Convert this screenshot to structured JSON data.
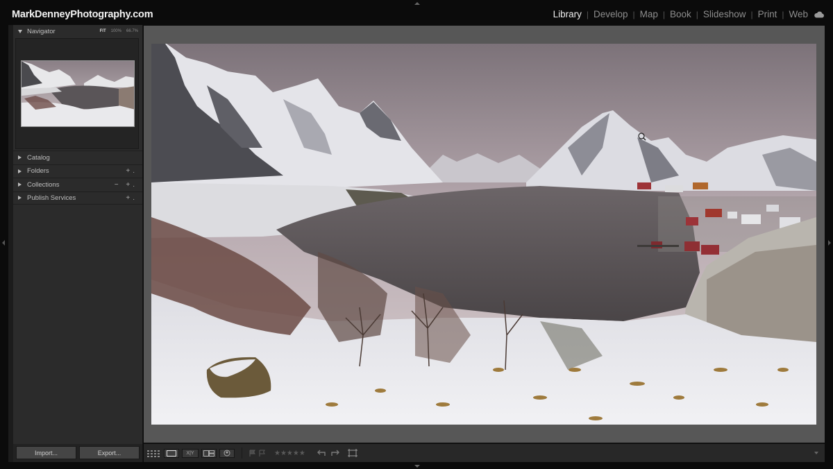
{
  "identity_plate": "MarkDenneyPhotography.com",
  "modules": [
    {
      "label": "Library",
      "active": true
    },
    {
      "label": "Develop",
      "active": false
    },
    {
      "label": "Map",
      "active": false
    },
    {
      "label": "Book",
      "active": false
    },
    {
      "label": "Slideshow",
      "active": false
    },
    {
      "label": "Print",
      "active": false
    },
    {
      "label": "Web",
      "active": false
    }
  ],
  "navigator": {
    "title": "Navigator",
    "zoom_options": [
      "FIT",
      "100%",
      "66.7%"
    ],
    "zoom_selected": "FIT"
  },
  "left_panels": [
    {
      "label": "Catalog",
      "actions": ""
    },
    {
      "label": "Folders",
      "actions": "+."
    },
    {
      "label": "Collections",
      "actions": "− +."
    },
    {
      "label": "Publish Services",
      "actions": "+."
    }
  ],
  "buttons": {
    "import": "Import...",
    "export": "Export..."
  },
  "toolbar": {
    "compare_label": "X|Y",
    "rating_stars": "★★★★★"
  },
  "colors": {
    "active_module": "#f0f0f0",
    "inactive_module": "#8e8e8e",
    "panel_bg": "#2b2b2b",
    "canvas_bg": "#575757"
  }
}
